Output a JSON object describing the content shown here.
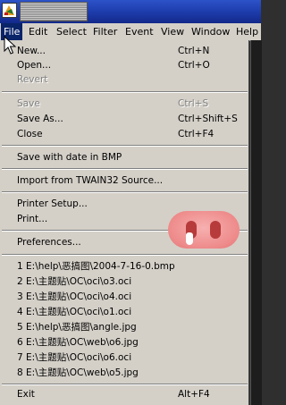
{
  "menubar": {
    "items": [
      "File",
      "Edit",
      "Select",
      "Filter",
      "Event",
      "View",
      "Window",
      "Help"
    ]
  },
  "file_menu": {
    "new": {
      "label": "New...",
      "shortcut": "Ctrl+N"
    },
    "open": {
      "label": "Open...",
      "shortcut": "Ctrl+O"
    },
    "revert": {
      "label": "Revert"
    },
    "save": {
      "label": "Save",
      "shortcut": "Ctrl+S"
    },
    "save_as": {
      "label": "Save As...",
      "shortcut": "Ctrl+Shift+S"
    },
    "close": {
      "label": "Close",
      "shortcut": "Ctrl+F4"
    },
    "save_bmp": {
      "label": "Save with date in BMP"
    },
    "import_twain": {
      "label": "Import from TWAIN32 Source..."
    },
    "printer_setup": {
      "label": "Printer Setup..."
    },
    "print": {
      "label": "Print..."
    },
    "preferences": {
      "label": "Preferences..."
    },
    "recent": [
      "1 E:\\help\\恶搞图\\2004-7-16-0.bmp",
      "2 E:\\主题贴\\OC\\oci\\o3.oci",
      "3 E:\\主题贴\\OC\\oci\\o4.oci",
      "4 E:\\主题贴\\OC\\oci\\o1.oci",
      "5 E:\\help\\恶搞图\\angle.jpg",
      "6 E:\\主题贴\\OC\\web\\o6.jpg",
      "7 E:\\主题贴\\OC\\oci\\o6.oci",
      "8 E:\\主题贴\\OC\\web\\o5.jpg"
    ],
    "exit": {
      "label": "Exit",
      "shortcut": "Alt+F4"
    }
  },
  "colors": {
    "menu_bg": "#d4d0c8",
    "highlight": "#0a246a",
    "titlebar": "#1f3fb0",
    "pig_nose": "#ee8a8a"
  },
  "icons": [
    "app-icon",
    "mouse-cursor-icon",
    "pig-nose-sticker"
  ]
}
